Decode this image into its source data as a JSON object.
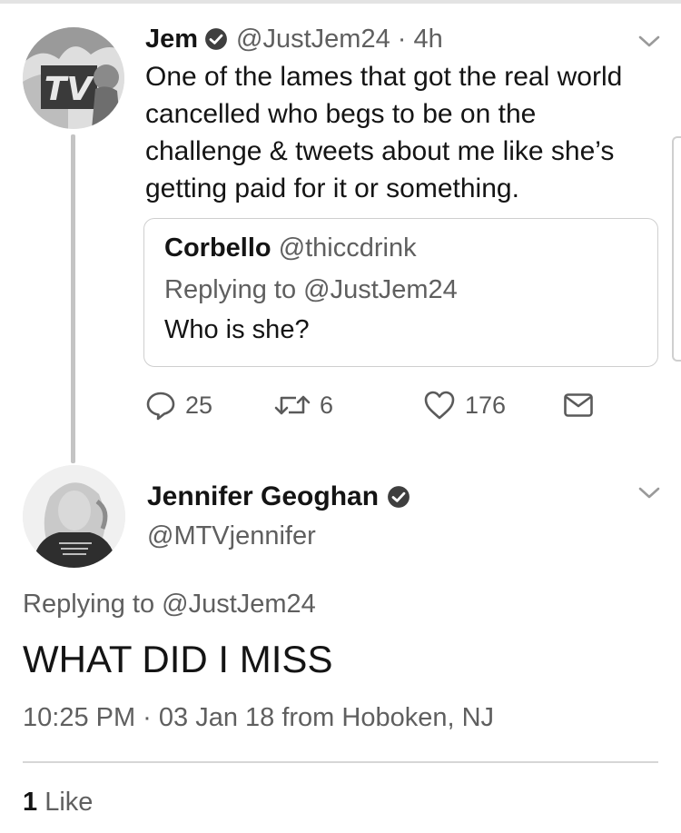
{
  "tweet1": {
    "name": "Jem",
    "handle_time": "@JustJem24 · 4h",
    "body_lines": [
      "One of the lames that got the real world",
      "cancelled who begs to be on the",
      "challenge & tweets about me like she’s",
      "getting paid for it or something."
    ],
    "avatar_logo": "TV",
    "quote": {
      "name": "Corbello",
      "handle": "@thiccdrink",
      "replying": "Replying to @JustJem24",
      "text": "Who is she?"
    },
    "actions": {
      "replies": "25",
      "retweets": "6",
      "likes": "176"
    }
  },
  "tweet2": {
    "name": "Jennifer Geoghan",
    "handle": "@MTVjennifer",
    "replying": "Replying to @JustJem24",
    "text": "WHAT DID I MISS",
    "meta": "10:25 PM · 03 Jan 18 from Hoboken, NJ",
    "like_count": "1",
    "like_label": "Like"
  },
  "icons": {
    "verified": "verified-badge-icon",
    "chevron": "chevron-down-icon",
    "reply": "reply-icon",
    "retweet": "retweet-icon",
    "like": "heart-icon",
    "dm": "envelope-icon"
  }
}
